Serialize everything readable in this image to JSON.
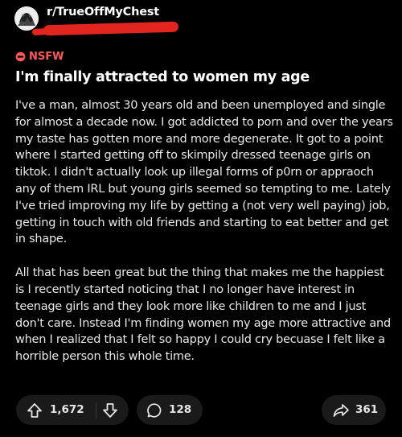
{
  "header": {
    "subreddit": "r/TrueOffMyChest"
  },
  "post": {
    "nsfw_label": "NSFW",
    "title": "I'm finally attracted to women my age",
    "paragraphs": [
      "I've a man, almost 30 years old and been unemployed and single for almost a decade now. I got addicted to porn and over the years my taste has gotten more and more degenerate. It got to a point where I started getting off to skimpily dressed teenage girls on tiktok. I didn't actually look up illegal forms of p0rn or appraoch any of them IRL but young girls seemed so tempting to me. Lately I've tried improving my life by getting a (not very well paying) job, getting in touch with old friends and starting to eat better and get in shape.",
      "All that has been great but the thing that makes me the happiest is I recently started noticing that I no longer have interest in teenage girls and they look more like children to me and I just don't care. Instead I'm finding women my age more attractive and when I realized that I felt so happy I could cry becuase I felt like a horrible person this whole time."
    ]
  },
  "actions": {
    "upvotes": "1,672",
    "comments": "128",
    "shares": "361"
  },
  "icons": {
    "upvote": "arrow-up-icon",
    "downvote": "arrow-down-icon",
    "comment": "speech-bubble-icon",
    "share": "share-arrow-icon",
    "nsfw": "nsfw-badge-icon",
    "avatar": "subreddit-avatar-icon"
  },
  "colors": {
    "background": "#000000",
    "nsfw": "#ff585b",
    "redaction": "#e2251f",
    "pill": "#1a1a1b"
  }
}
